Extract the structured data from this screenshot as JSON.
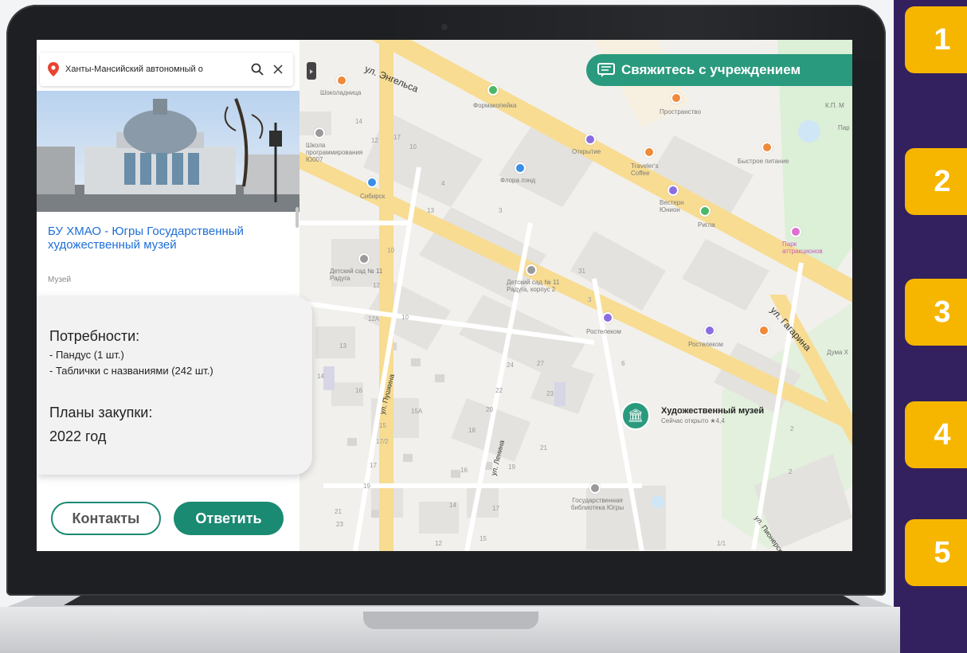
{
  "search": {
    "value": "Ханты-Мансийский автономный о",
    "search_icon": "search-icon",
    "close_icon": "close-icon"
  },
  "organization": {
    "name": "БУ ХМАО - Югры Государственный художественный музей",
    "type": "Музей"
  },
  "card": {
    "needs_title": "Потребности:",
    "needs": [
      "- Пандус (1 шт.)",
      "- Таблички с названиями (242 шт.)"
    ],
    "plans_title": "Планы закупки:",
    "plans_value": "2022 год"
  },
  "buttons": {
    "contacts": "Контакты",
    "reply": "Ответить"
  },
  "contact_button": {
    "label": "Свяжитесь с учреждением",
    "icon": "chat-icon"
  },
  "map": {
    "streets": {
      "engelsa": "ул. Энгельса",
      "gagarina": "ул. Гагарина",
      "pushkina": "ул. Пушкина",
      "lenina": "ул. Ленина",
      "pionerskaya": "ул. Пионерская"
    },
    "places": {
      "shokoladnitsa": "Шоколадница",
      "formakopeika": "Формакопейка",
      "prostranstvo": "Пространство",
      "km": "К.П. М",
      "par": "Пар",
      "shkola": "Школа программирования Ю007",
      "otkrytie": "Открытие",
      "travelers": "Traveler's Coffee",
      "bystroe": "Быстрое питание",
      "flora": "Флора лэнд",
      "sibirsk": "Сибирск",
      "vestern": "Вестерн Юнион",
      "rigla": "Ригла",
      "park": "Парк аттракционов",
      "detsad1": "Детский сад № 11 Радуга",
      "detsad2": "Детский сад № 11 Радуга, корпус 2",
      "rostelecom1": "Ростелеком",
      "rostelecom2": "Ростелеком",
      "duma": "Дума Х",
      "library": "Государственная библиотека Югры"
    },
    "museum": {
      "title": "Художественный музей",
      "subtitle": "Сейчас открыто ★4,4"
    },
    "building_numbers": [
      "14",
      "12",
      "17",
      "10",
      "13",
      "3",
      "4",
      "10",
      "31",
      "6",
      "3",
      "12",
      "12А",
      "10",
      "13",
      "14",
      "16",
      "15А",
      "24",
      "22",
      "27",
      "23",
      "20",
      "18",
      "15",
      "17/2",
      "17",
      "19",
      "21",
      "23",
      "16",
      "19",
      "14",
      "17",
      "12",
      "15",
      "21",
      "2",
      "1/1",
      "2"
    ]
  },
  "side_tabs": [
    "1",
    "2",
    "3",
    "4",
    "5"
  ],
  "colors": {
    "accent": "#2a9a7e",
    "tab": "#f6b600",
    "band": "#32205f",
    "link": "#1d6ed8"
  }
}
